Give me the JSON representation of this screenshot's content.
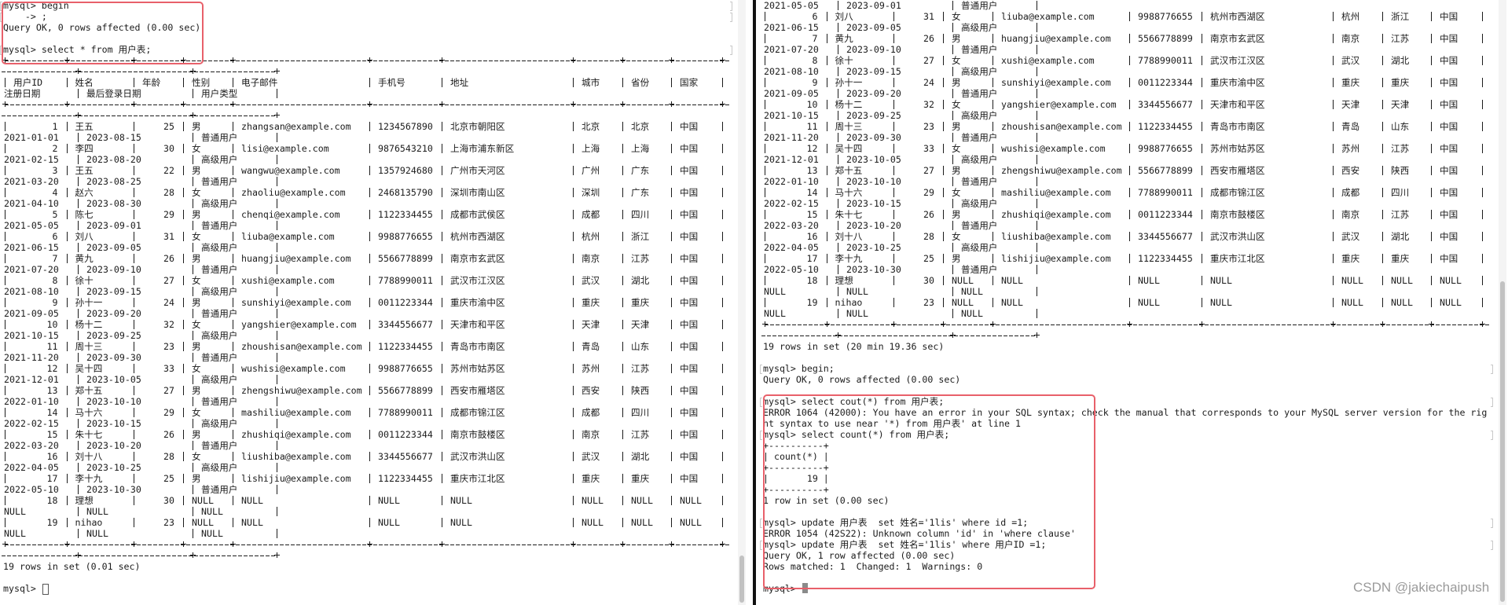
{
  "table": {
    "headers_line1": [
      "用户ID",
      "姓名",
      "年龄",
      "性别",
      "电子邮件",
      "手机号",
      "地址",
      "城市",
      "省份",
      "国家"
    ],
    "headers_line2": [
      "注册日期",
      "最后登录日期",
      "用户类型"
    ],
    "rows": [
      [
        "1",
        "王五",
        "25",
        "男",
        "zhangsan@example.com",
        "1234567890",
        "北京市朝阳区",
        "北京",
        "北京",
        "中国",
        "2021-01-01",
        "2023-08-15",
        "普通用户"
      ],
      [
        "2",
        "李四",
        "30",
        "女",
        "lisi@example.com",
        "9876543210",
        "上海市浦东新区",
        "上海",
        "上海",
        "中国",
        "2021-02-15",
        "2023-08-20",
        "高级用户"
      ],
      [
        "3",
        "王五",
        "22",
        "男",
        "wangwu@example.com",
        "1357924680",
        "广州市天河区",
        "广州",
        "广东",
        "中国",
        "2021-03-20",
        "2023-08-25",
        "普通用户"
      ],
      [
        "4",
        "赵六",
        "28",
        "女",
        "zhaoliu@example.com",
        "2468135790",
        "深圳市南山区",
        "深圳",
        "广东",
        "中国",
        "2021-04-10",
        "2023-08-30",
        "高级用户"
      ],
      [
        "5",
        "陈七",
        "29",
        "男",
        "chenqi@example.com",
        "1122334455",
        "成都市武侯区",
        "成都",
        "四川",
        "中国",
        "2021-05-05",
        "2023-09-01",
        "普通用户"
      ],
      [
        "6",
        "刘八",
        "31",
        "女",
        "liuba@example.com",
        "9988776655",
        "杭州市西湖区",
        "杭州",
        "浙江",
        "中国",
        "2021-06-15",
        "2023-09-05",
        "高级用户"
      ],
      [
        "7",
        "黄九",
        "26",
        "男",
        "huangjiu@example.com",
        "5566778899",
        "南京市玄武区",
        "南京",
        "江苏",
        "中国",
        "2021-07-20",
        "2023-09-10",
        "普通用户"
      ],
      [
        "8",
        "徐十",
        "27",
        "女",
        "xushi@example.com",
        "7788990011",
        "武汉市江汉区",
        "武汉",
        "湖北",
        "中国",
        "2021-08-10",
        "2023-09-15",
        "高级用户"
      ],
      [
        "9",
        "孙十一",
        "24",
        "男",
        "sunshiyi@example.com",
        "0011223344",
        "重庆市渝中区",
        "重庆",
        "重庆",
        "中国",
        "2021-09-05",
        "2023-09-20",
        "普通用户"
      ],
      [
        "10",
        "杨十二",
        "32",
        "女",
        "yangshier@example.com",
        "3344556677",
        "天津市和平区",
        "天津",
        "天津",
        "中国",
        "2021-10-15",
        "2023-09-25",
        "高级用户"
      ],
      [
        "11",
        "周十三",
        "23",
        "男",
        "zhoushisan@example.com",
        "1122334455",
        "青岛市市南区",
        "青岛",
        "山东",
        "中国",
        "2021-11-20",
        "2023-09-30",
        "普通用户"
      ],
      [
        "12",
        "吴十四",
        "33",
        "女",
        "wushisi@example.com",
        "9988776655",
        "苏州市姑苏区",
        "苏州",
        "江苏",
        "中国",
        "2021-12-01",
        "2023-10-05",
        "高级用户"
      ],
      [
        "13",
        "郑十五",
        "27",
        "男",
        "zhengshiwu@example.com",
        "5566778899",
        "西安市雁塔区",
        "西安",
        "陕西",
        "中国",
        "2022-01-10",
        "2023-10-10",
        "普通用户"
      ],
      [
        "14",
        "马十六",
        "29",
        "女",
        "mashiliu@example.com",
        "7788990011",
        "成都市锦江区",
        "成都",
        "四川",
        "中国",
        "2022-02-15",
        "2023-10-15",
        "高级用户"
      ],
      [
        "15",
        "朱十七",
        "26",
        "男",
        "zhushiqi@example.com",
        "0011223344",
        "南京市鼓楼区",
        "南京",
        "江苏",
        "中国",
        "2022-03-20",
        "2023-10-20",
        "普通用户"
      ],
      [
        "16",
        "刘十八",
        "28",
        "女",
        "liushiba@example.com",
        "3344556677",
        "武汉市洪山区",
        "武汉",
        "湖北",
        "中国",
        "2022-04-05",
        "2023-10-25",
        "高级用户"
      ],
      [
        "17",
        "李十九",
        "25",
        "男",
        "lishijiu@example.com",
        "1122334455",
        "重庆市江北区",
        "重庆",
        "重庆",
        "中国",
        "2022-05-10",
        "2023-10-30",
        "普通用户"
      ],
      [
        "18",
        "理想",
        "30",
        "NULL",
        "NULL",
        "NULL",
        "NULL",
        "NULL",
        "NULL",
        "NULL",
        "NULL",
        "NULL",
        "NULL"
      ],
      [
        "19",
        "nihao",
        "23",
        "NULL",
        "NULL",
        "NULL",
        "NULL",
        "NULL",
        "NULL",
        "NULL",
        "NULL",
        "NULL",
        "NULL"
      ]
    ]
  },
  "left_pane": {
    "cmd_begin": "mysql> begin",
    "cmd_continue": "    -> ;",
    "begin_result": "Query OK, 0 rows affected (0.00 sec)",
    "cmd_select": "mysql> select * from 用户表;",
    "select_result": "19 rows in set (0.01 sec)",
    "prompt": "mysql> "
  },
  "right_pane": {
    "select_result": "19 rows in set (20 min 19.36 sec)",
    "cmd_begin": "mysql> begin;",
    "begin_result": "Query OK, 0 rows affected (0.00 sec)",
    "cmd_cout": "mysql> select cout(*) from 用户表;",
    "error_1064_line1": "ERROR 1064 (42000): You have an error in your SQL syntax; check the manual that corresponds to your MySQL server version for the rig",
    "error_1064_line2": "ht syntax to use near '*) from 用户表' at line 1",
    "cmd_count": "mysql> select count(*) from 用户表;",
    "count_table": [
      "+----------+",
      "| count(*) |",
      "+----------+",
      "|       19 |",
      "+----------+"
    ],
    "count_result": "1 row in set (0.00 sec)",
    "cmd_update_id": "mysql> update 用户表  set 姓名='1lis' where id =1;",
    "error_1054": "ERROR 1054 (42S22): Unknown column 'id' in 'where clause'",
    "cmd_update_userid": "mysql> update 用户表  set 姓名='1lis' where 用户ID =1;",
    "update_result": "Query OK, 1 row affected (0.00 sec)",
    "update_stats": "Rows matched: 1  Changed: 1  Warnings: 0",
    "prompt": "mysql> "
  },
  "watermark": "CSDN @jakiechaipush",
  "colors": {
    "highlight_box": "#e8606a",
    "text": "#1b1b1b",
    "background": "#ffffff"
  }
}
